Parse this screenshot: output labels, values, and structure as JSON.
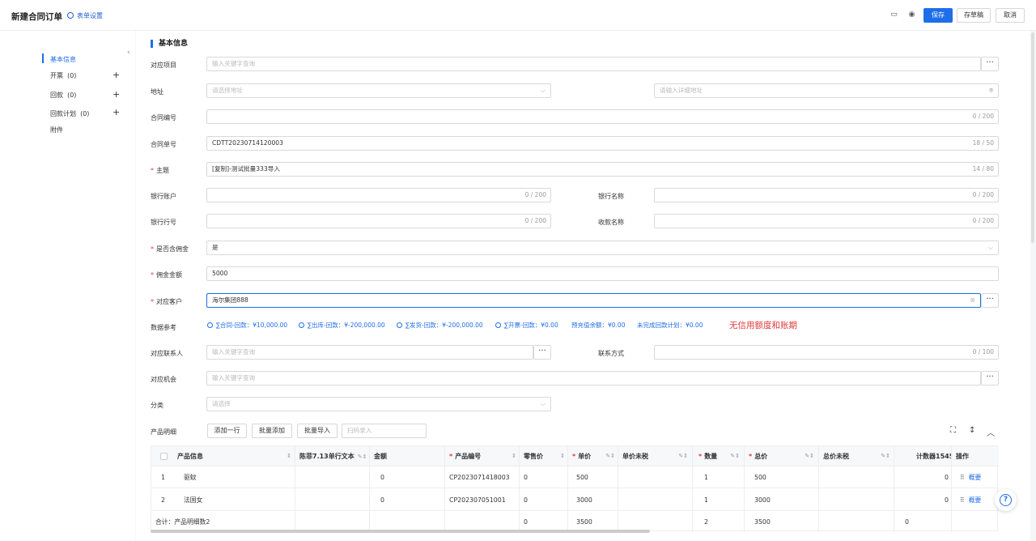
{
  "header": {
    "title": "新建合同订单",
    "form_settings": "表单设置",
    "save": "保存",
    "draft": "存草稿",
    "cancel": "取消"
  },
  "sidebar": {
    "items": [
      {
        "label": "基本信息"
      },
      {
        "label": "开票",
        "count": "(0)"
      },
      {
        "label": "回款",
        "count": "(0)"
      },
      {
        "label": "回款计划",
        "count": "(0)"
      },
      {
        "label": "附件"
      }
    ]
  },
  "section": {
    "title": "基本信息"
  },
  "form": {
    "project": {
      "label": "对应项目",
      "placeholder": "输入关键字查询"
    },
    "address": {
      "label": "地址",
      "select_placeholder": "请选择地址",
      "detail_placeholder": "请输入详细地址"
    },
    "contract_no": {
      "label": "合同编号",
      "value": "",
      "count": "0 / 200"
    },
    "order_no": {
      "label": "合同单号",
      "value": "CDTT20230714120003",
      "count": "18 / 50"
    },
    "subject": {
      "label": "主题",
      "value": "[复制]-测试批量333导入",
      "count": "14 / 80"
    },
    "bank_account": {
      "label": "银行账户",
      "count": "0 / 200"
    },
    "bank_name": {
      "label": "银行名称",
      "count": "0 / 200"
    },
    "bank_code": {
      "label": "银行行号",
      "count": "0 / 200"
    },
    "payee_name": {
      "label": "收款名称",
      "count": "0 / 200"
    },
    "commission_flag": {
      "label": "是否含佣金",
      "value": "是"
    },
    "commission_amount": {
      "label": "佣金金额",
      "value": "5000"
    },
    "customer": {
      "label": "对应客户",
      "value": "海尔集团888"
    },
    "data_ref": {
      "label": "数据参考",
      "items": [
        "∑合同-回款：¥10,000.00",
        "∑出库-回款：¥-200,000.00",
        "∑发货-回款：¥-200,000.00",
        "∑开票-回款：¥0.00"
      ],
      "plain": [
        "预充值余额：¥0.00",
        "未完成回款计划：¥0.00"
      ],
      "note": "无信用额度和账期"
    },
    "contact": {
      "label": "对应联系人",
      "placeholder": "输入关键字查询"
    },
    "contact_method": {
      "label": "联系方式",
      "count": "0 / 100"
    },
    "opportunity": {
      "label": "对应机会",
      "placeholder": "输入关键字查询"
    },
    "category": {
      "label": "分类",
      "placeholder": "请选择"
    },
    "products": {
      "label": "产品明细",
      "add_row": "添加一行",
      "batch_add": "批量添加",
      "batch_import": "批量导入",
      "scan_placeholder": "扫码录入"
    }
  },
  "table": {
    "columns": [
      "产品信息",
      "陈菲7.13单行文本",
      "金额",
      "产品编号",
      "零售价",
      "单价",
      "单价未税",
      "数量",
      "总价",
      "总价未税",
      "计数器1545",
      "操作"
    ],
    "rows": [
      {
        "idx": "1",
        "name": "驱蚊",
        "amount": "0",
        "code": "CP2023071418003",
        "retail": "0",
        "price": "500",
        "qty": "1",
        "total": "500",
        "counter": "0",
        "op": "概要"
      },
      {
        "idx": "2",
        "name": "法国女",
        "amount": "0",
        "code": "CP202307051001",
        "retail": "0",
        "price": "3000",
        "qty": "1",
        "total": "3000",
        "counter": "0",
        "op": "概要"
      }
    ],
    "summary": {
      "label": "合计：产品明细数2",
      "retail": "0",
      "price": "3500",
      "qty": "2",
      "total": "3500",
      "counter": "0"
    }
  }
}
